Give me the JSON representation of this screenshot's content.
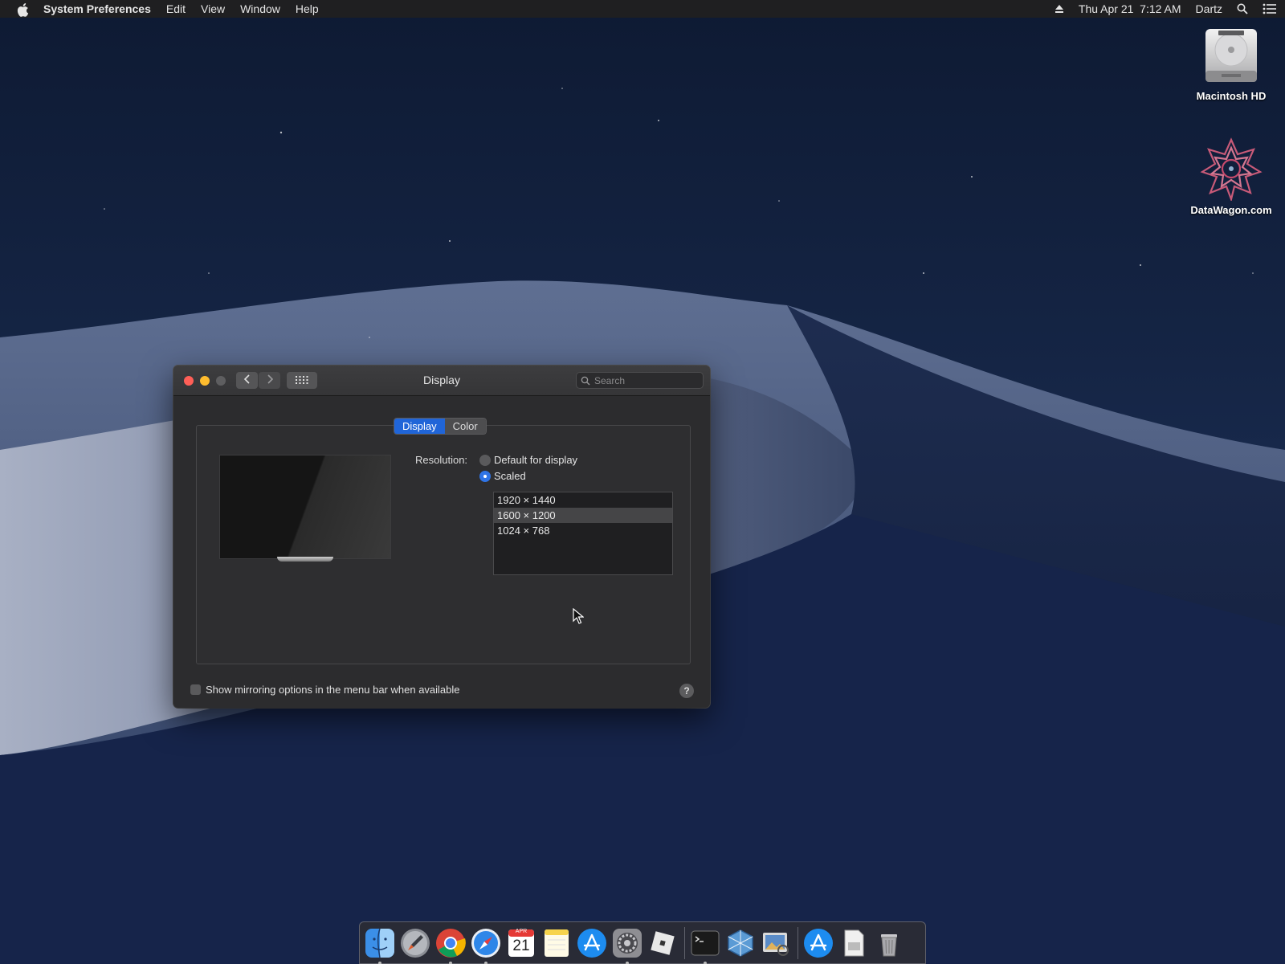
{
  "menubar": {
    "app_name": "System Preferences",
    "menus": [
      "Edit",
      "View",
      "Window",
      "Help"
    ],
    "datetime": "Thu Apr 21  7:12 AM",
    "user": "Dartz"
  },
  "desktop_icons": [
    {
      "label": "Macintosh HD",
      "icon": "hard-drive-icon"
    },
    {
      "label": "DataWagon.com",
      "icon": "datawagon-logo-icon"
    }
  ],
  "window": {
    "title": "Display",
    "search_placeholder": "Search",
    "tabs": [
      {
        "label": "Display",
        "active": true
      },
      {
        "label": "Color",
        "active": false
      }
    ],
    "resolution_label": "Resolution:",
    "resolution_options": [
      {
        "label": "Default for display",
        "selected": false
      },
      {
        "label": "Scaled",
        "selected": true
      }
    ],
    "scaled_resolutions": [
      {
        "label": "1920 × 1440",
        "selected": false
      },
      {
        "label": "1600 × 1200",
        "selected": true
      },
      {
        "label": "1024 × 768",
        "selected": false
      }
    ],
    "mirroring_checkbox": {
      "label": "Show mirroring options in the menu bar when available",
      "checked": false
    },
    "help_label": "?"
  },
  "dock": {
    "items": [
      "finder-icon",
      "launchpad-icon",
      "chrome-icon",
      "safari-icon",
      "calendar-icon",
      "notes-icon",
      "app-store-icon",
      "system-preferences-icon",
      "roblox-icon",
      "terminal-icon",
      "virtualbox-icon",
      "preview-icon",
      "app-store-downloads-icon",
      "documents-icon",
      "trash-icon"
    ],
    "calendar": {
      "month": "APR",
      "day": "21"
    }
  },
  "colors": {
    "accent": "#2065d8",
    "menubar_bg": "#1f1f21",
    "window_bg": "#2c2c2e",
    "close": "#ff5f57",
    "minimize": "#febc2e"
  }
}
